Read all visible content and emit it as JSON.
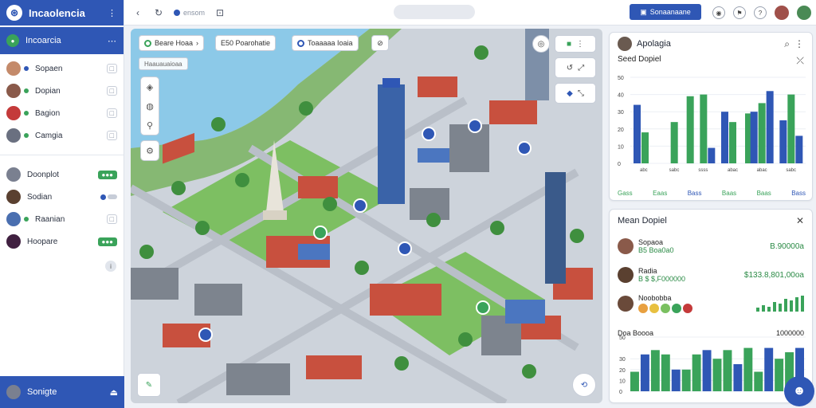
{
  "app": {
    "title": "Incaolencia"
  },
  "sidebar": {
    "active": {
      "label": "Incoarcia"
    },
    "groups": [
      [
        {
          "label": "Sopaen",
          "dot": "#2f57b5",
          "avatar": "#c48a6a"
        },
        {
          "label": "Dopian",
          "dot": "#3aa35a",
          "avatar": "#8a5a4a"
        },
        {
          "label": "Bagion",
          "dot": "#3aa35a",
          "avatar": "#c43a3a"
        },
        {
          "label": "Camgia",
          "dot": "#3aa35a",
          "avatar": "#6a7080"
        }
      ],
      [
        {
          "label": "Doonplot",
          "dot": "",
          "avatar": "#7a8090",
          "badge": "green"
        },
        {
          "label": "Sodian",
          "dot": "",
          "avatar": "#5a4030",
          "badge": "blue"
        },
        {
          "label": "Raanian",
          "dot": "#3aa35a",
          "avatar": "#4a6fb0"
        },
        {
          "label": "Hoopare",
          "dot": "",
          "avatar": "#402040",
          "badge": "green"
        }
      ]
    ],
    "footer": {
      "label": "Sonigte"
    }
  },
  "topbar": {
    "address": "ensom",
    "search_placeholder": "",
    "button_label": "Sonaanaane"
  },
  "map": {
    "chips": [
      "Beare Hoaa",
      "E50 Poarohatie",
      "Toaaaaa Ioaia"
    ],
    "subchip": "Haauauaioaa"
  },
  "panel1": {
    "title": "Apolagia",
    "subtitle": "Seed Dopiel",
    "chart_data": {
      "type": "bar",
      "categories": [
        "abc",
        "sabc",
        "ssss",
        "abac",
        "abac",
        "sabc"
      ],
      "series": [
        {
          "color": "#2f57b5",
          "values": [
            34,
            0,
            0,
            30,
            30,
            25
          ]
        },
        {
          "color": "#3aa35a",
          "values": [
            18,
            24,
            40,
            24,
            35,
            40
          ]
        },
        {
          "color": "#2f57b5",
          "values": [
            0,
            0,
            9,
            0,
            42,
            16
          ]
        },
        {
          "color": "#3aa35a",
          "values": [
            0,
            39,
            0,
            29,
            0,
            0
          ]
        }
      ],
      "ylim": [
        0,
        50
      ],
      "yticks": [
        "0",
        "10",
        "20",
        "30",
        "40",
        "50"
      ]
    },
    "legend": [
      "Gass",
      "Eaas",
      "Bass",
      "Baas",
      "Baas",
      "Bass"
    ]
  },
  "panel2": {
    "title": "Mean Dopiel",
    "rows": [
      {
        "label": "Sopaoa",
        "sublabel": "B5 Boa0a0",
        "value": "B.90000a",
        "avatar": "#8a5a4a"
      },
      {
        "label": "Radia",
        "sublabel": "B $ $,F000000",
        "value": "$133.8,801,00oa",
        "avatar": "#5a4030"
      },
      {
        "label": "Noobobba",
        "sublabel": "",
        "value": "",
        "avatar": "#6a4a3a"
      }
    ],
    "swatches": [
      "#e8a040",
      "#e8c040",
      "#7ac060",
      "#3aa35a",
      "#c43a3a"
    ],
    "foot_left": "Doa Boooa",
    "foot_right": "1000000",
    "chart_data": {
      "type": "bar",
      "categories": [
        "",
        "",
        "",
        "",
        "",
        "",
        "",
        "",
        "",
        "",
        "",
        "",
        "",
        "",
        "",
        "",
        ""
      ],
      "values": [
        18,
        34,
        38,
        34,
        20,
        20,
        34,
        38,
        30,
        38,
        25,
        40,
        18,
        40,
        30,
        36,
        40
      ],
      "ylim": [
        0,
        50
      ],
      "yticks": [
        "0",
        "10",
        "20",
        "30",
        "50"
      ]
    }
  }
}
